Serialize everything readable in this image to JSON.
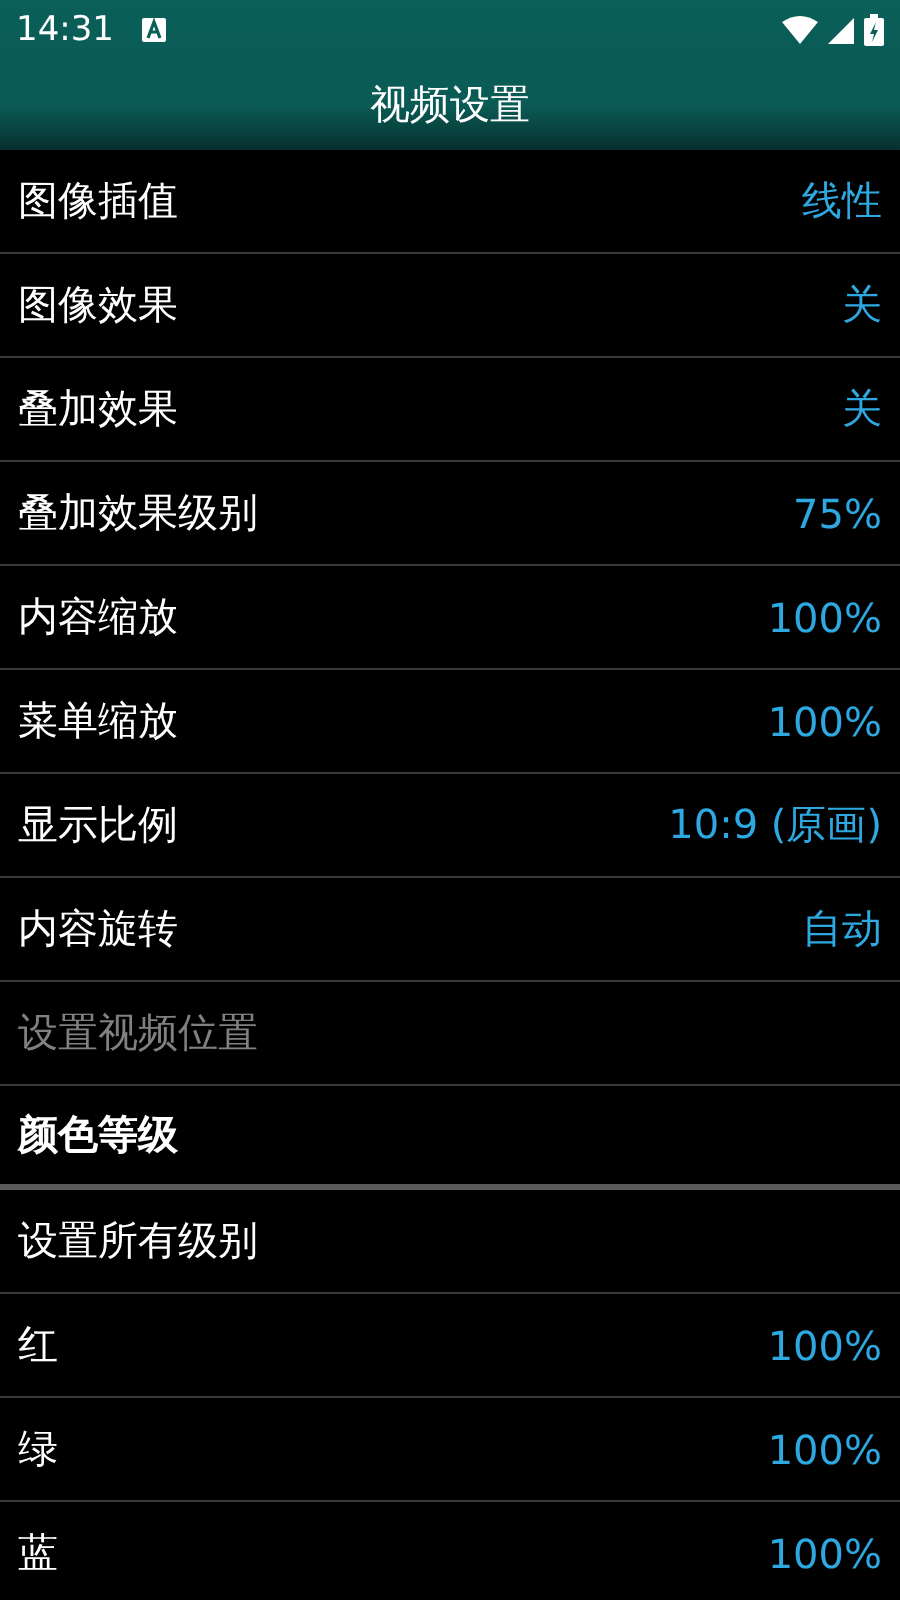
{
  "status_bar": {
    "time": "14:31"
  },
  "title": "视频设置",
  "rows": [
    {
      "kind": "item",
      "label": "图像插值",
      "value": "线性",
      "disabled": false
    },
    {
      "kind": "item",
      "label": "图像效果",
      "value": "关",
      "disabled": false
    },
    {
      "kind": "item",
      "label": "叠加效果",
      "value": "关",
      "disabled": false
    },
    {
      "kind": "item",
      "label": "叠加效果级别",
      "value": "75%",
      "disabled": false
    },
    {
      "kind": "item",
      "label": "内容缩放",
      "value": "100%",
      "disabled": false
    },
    {
      "kind": "item",
      "label": "菜单缩放",
      "value": "100%",
      "disabled": false
    },
    {
      "kind": "item",
      "label": "显示比例",
      "value": "10:9 (原画)",
      "disabled": false
    },
    {
      "kind": "item",
      "label": "内容旋转",
      "value": "自动",
      "disabled": false
    },
    {
      "kind": "item",
      "label": "设置视频位置",
      "disabled": true
    },
    {
      "kind": "header",
      "label": "颜色等级"
    },
    {
      "kind": "item",
      "label": "设置所有级别",
      "disabled": false
    },
    {
      "kind": "item",
      "label": "红",
      "value": "100%",
      "disabled": false
    },
    {
      "kind": "item",
      "label": "绿",
      "value": "100%",
      "disabled": false
    },
    {
      "kind": "item",
      "label": "蓝",
      "value": "100%",
      "disabled": false
    }
  ]
}
